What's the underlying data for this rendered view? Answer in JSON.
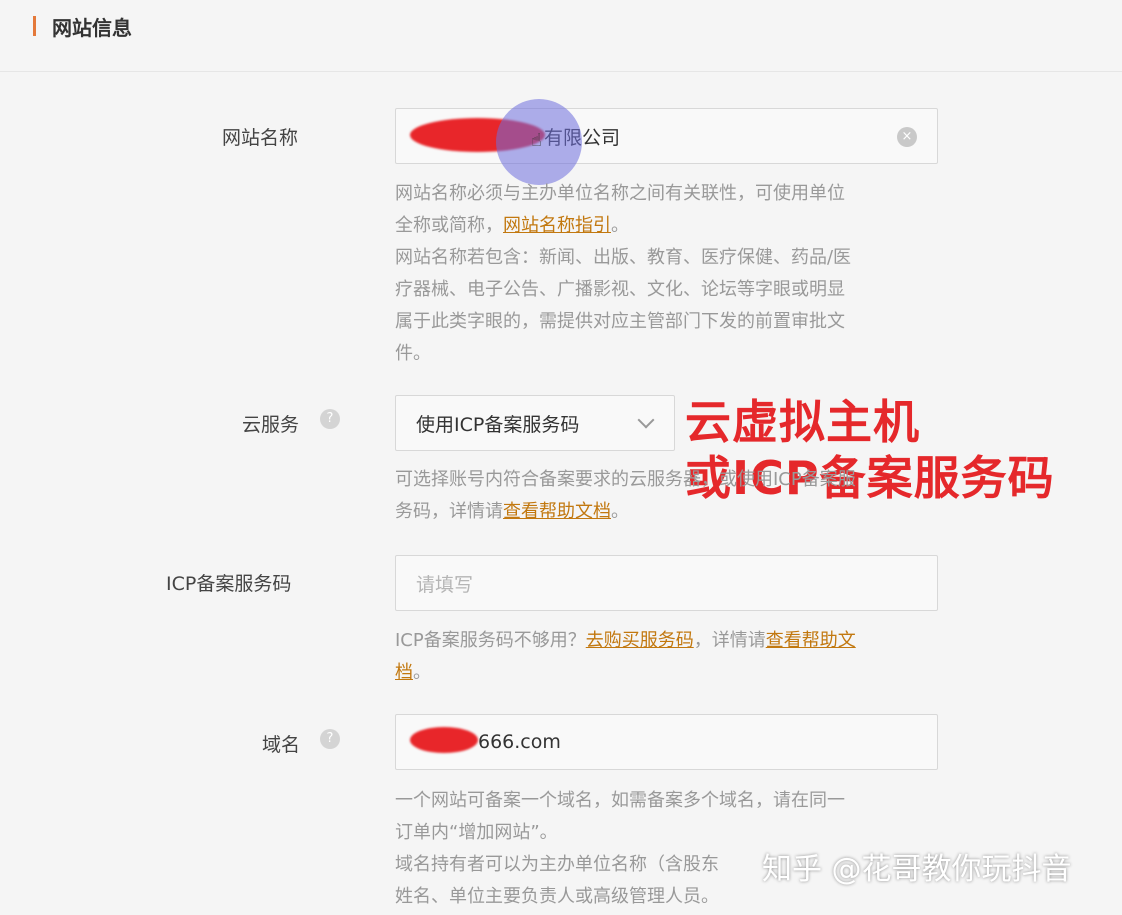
{
  "section": {
    "title": "网站信息"
  },
  "site_name": {
    "label": "网站名称",
    "value_suffix": "有限公司",
    "help_line1": "网站名称必须与主办单位名称之间有关联性，可使用单位",
    "help_line2_pre": "全称或简称，",
    "help_link": "网站名称指引",
    "help_line2_post": "。",
    "help_line3": "网站名称若包含：新闻、出版、教育、医疗保健、药品/医",
    "help_line4": "疗器械、电子公告、广播影视、文化、论坛等字眼或明显",
    "help_line5": "属于此类字眼的，需提供对应主管部门下发的前置审批文",
    "help_line6": "件。"
  },
  "cloud_service": {
    "label": "云服务",
    "selected": "使用ICP备案服务码",
    "help_line1": "可选择账号内符合备案要求的云服务器，或使用ICP备案服",
    "help_line2_pre": "务码，详情请",
    "help_link": "查看帮助文档",
    "help_line2_post": "。"
  },
  "annotation": {
    "line1": "云虚拟主机",
    "line2": "或ICP备案服务码"
  },
  "icp_code": {
    "label": "ICP备案服务码",
    "placeholder": "请填写",
    "help_pre": "ICP备案服务码不够用？",
    "buy_link": "去购买服务码",
    "help_mid": "，详情请",
    "doc_link1": "查看帮助文",
    "doc_link2": "档",
    "help_post": "。"
  },
  "domain": {
    "label": "域名",
    "value_suffix": "666.com",
    "help_line1": "一个网站可备案一个域名，如需备案多个域名，请在同一",
    "help_line2": "订单内“增加网站”。",
    "help_line3": "域名持有者可以为主办单位名称（含股东",
    "help_line4": "姓名、单位主要负责人或高级管理人员。"
  },
  "watermark": "知乎 @花哥教你玩抖音",
  "icons": {
    "help": "question-circle-icon",
    "clear": "clear-circle-icon",
    "dropdown": "chevron-down-icon",
    "cursor": "hand-pointer-icon"
  },
  "colors": {
    "accent": "#e4793a",
    "link": "#c2780f",
    "annotation": "#e5282b"
  }
}
